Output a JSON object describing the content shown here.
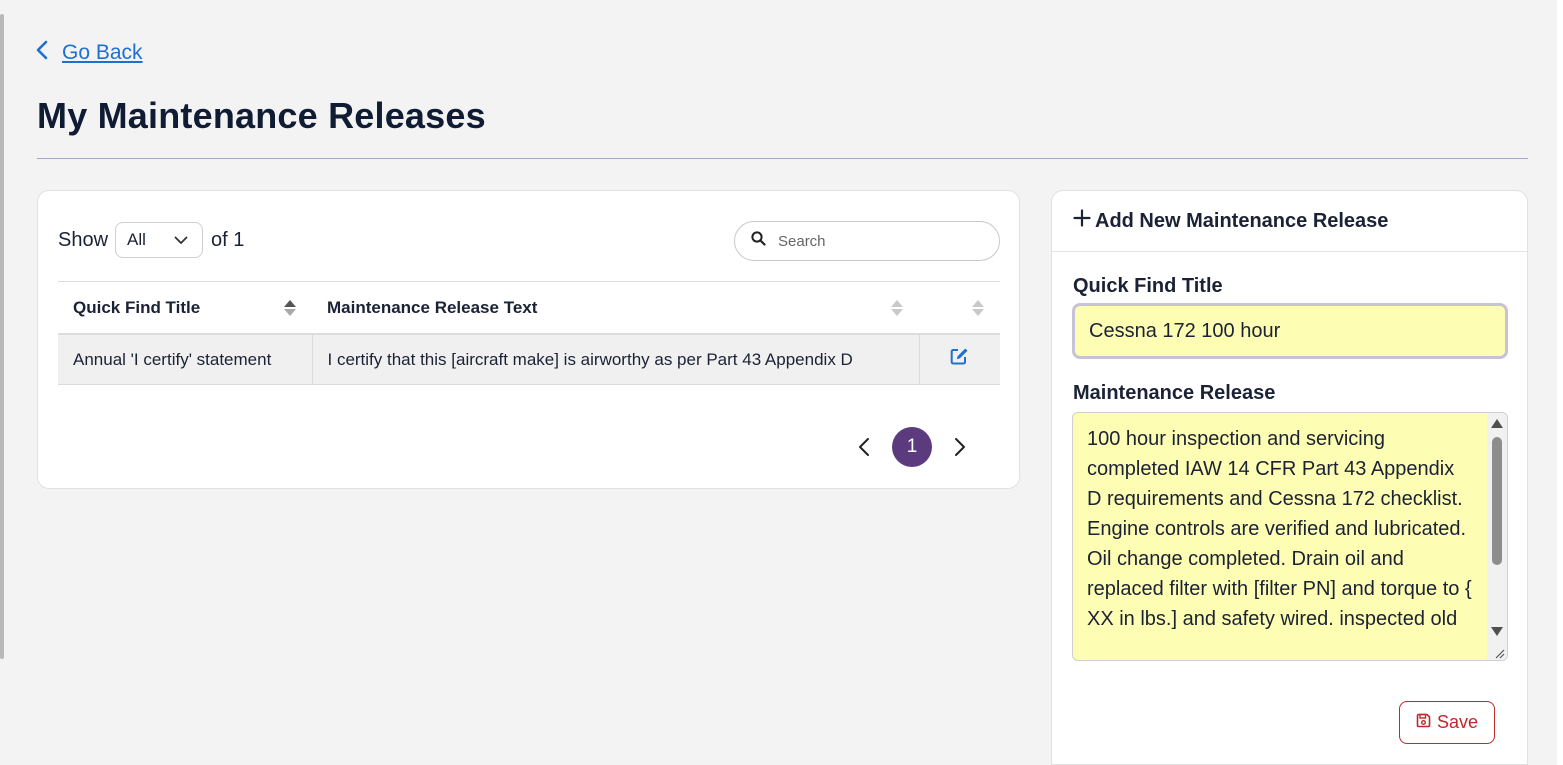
{
  "nav": {
    "back_label": "Go Back"
  },
  "page": {
    "title": "My Maintenance Releases"
  },
  "list": {
    "show_label": "Show",
    "page_size_value": "All",
    "of_label": "of 1",
    "search_placeholder": "Search",
    "columns": [
      "Quick Find Title",
      "Maintenance Release Text"
    ],
    "rows": [
      {
        "title": "Annual 'I certify' statement",
        "text": "I certify that this [aircraft make] is airworthy as per Part 43 Appendix D"
      }
    ],
    "current_page": "1"
  },
  "add_form": {
    "header_label": "Add New Maintenance Release",
    "title_field_label": "Quick Find Title",
    "title_value": "Cessna 172 100 hour",
    "release_field_label": "Maintenance Release",
    "release_value": "100 hour inspection and servicing completed IAW 14 CFR Part 43 Appendix D requirements and Cessna 172 checklist. Engine controls are verified and lubricated. Oil change completed. Drain oil and replaced filter with [filter PN] and torque to { XX in lbs.] and safety wired. inspected old",
    "save_label": "Save"
  },
  "colors": {
    "accent_link": "#1f6fd1",
    "page_bubble": "#5b3b7e",
    "input_highlight": "#fdfdb3",
    "save_red": "#c0282b"
  },
  "icons": {
    "back": "chevron-left-icon",
    "select": "chevron-down-icon",
    "search": "search-icon",
    "edit": "edit-icon",
    "add": "plus-icon",
    "save": "floppy-disk-icon"
  }
}
